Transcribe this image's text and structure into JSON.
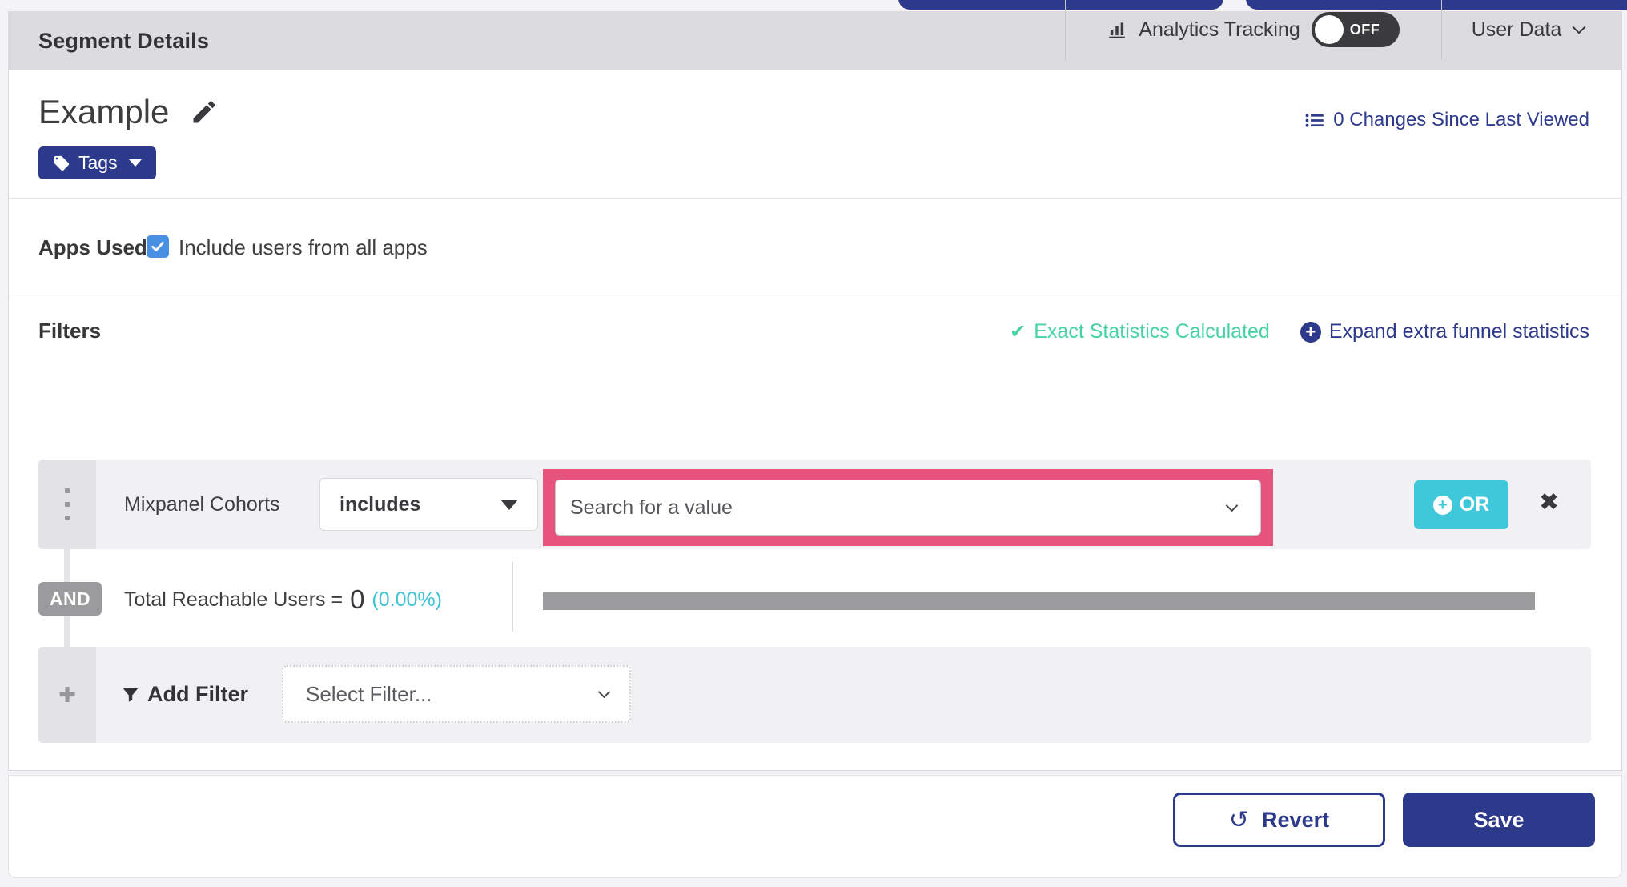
{
  "header": {
    "title": "Segment Details",
    "analytics_tracking": {
      "label": "Analytics Tracking",
      "toggle": "OFF"
    },
    "user_data": {
      "label": "User Data"
    }
  },
  "segment": {
    "name": "Example",
    "changes_link": "0 Changes Since Last Viewed",
    "tags_button": "Tags"
  },
  "apps_used": {
    "label": "Apps Used",
    "include_all_label": "Include users from all apps",
    "checked": true
  },
  "filters": {
    "heading": "Filters",
    "exact_statistics": "Exact Statistics Calculated",
    "expand_funnel": "Expand extra funnel statistics",
    "row": {
      "field": "Mixpanel Cohorts",
      "operator": "includes",
      "value_placeholder": "Search for a value",
      "or_button": "OR"
    },
    "connector": "AND",
    "reachable": {
      "label": "Total Reachable Users =",
      "value": "0",
      "percent": "(0.00%)"
    },
    "add_filter": {
      "label": "Add Filter",
      "placeholder": "Select Filter..."
    }
  },
  "footer": {
    "revert": "Revert",
    "save": "Save"
  },
  "colors": {
    "navy": "#2d3a8c",
    "teal": "#3fc8da",
    "green": "#47d2a4",
    "pink_highlight": "#e6537d",
    "gray_bar": "#9b9b9e",
    "checkbox_blue": "#4a90e2",
    "header_gray": "#dcdce0"
  }
}
